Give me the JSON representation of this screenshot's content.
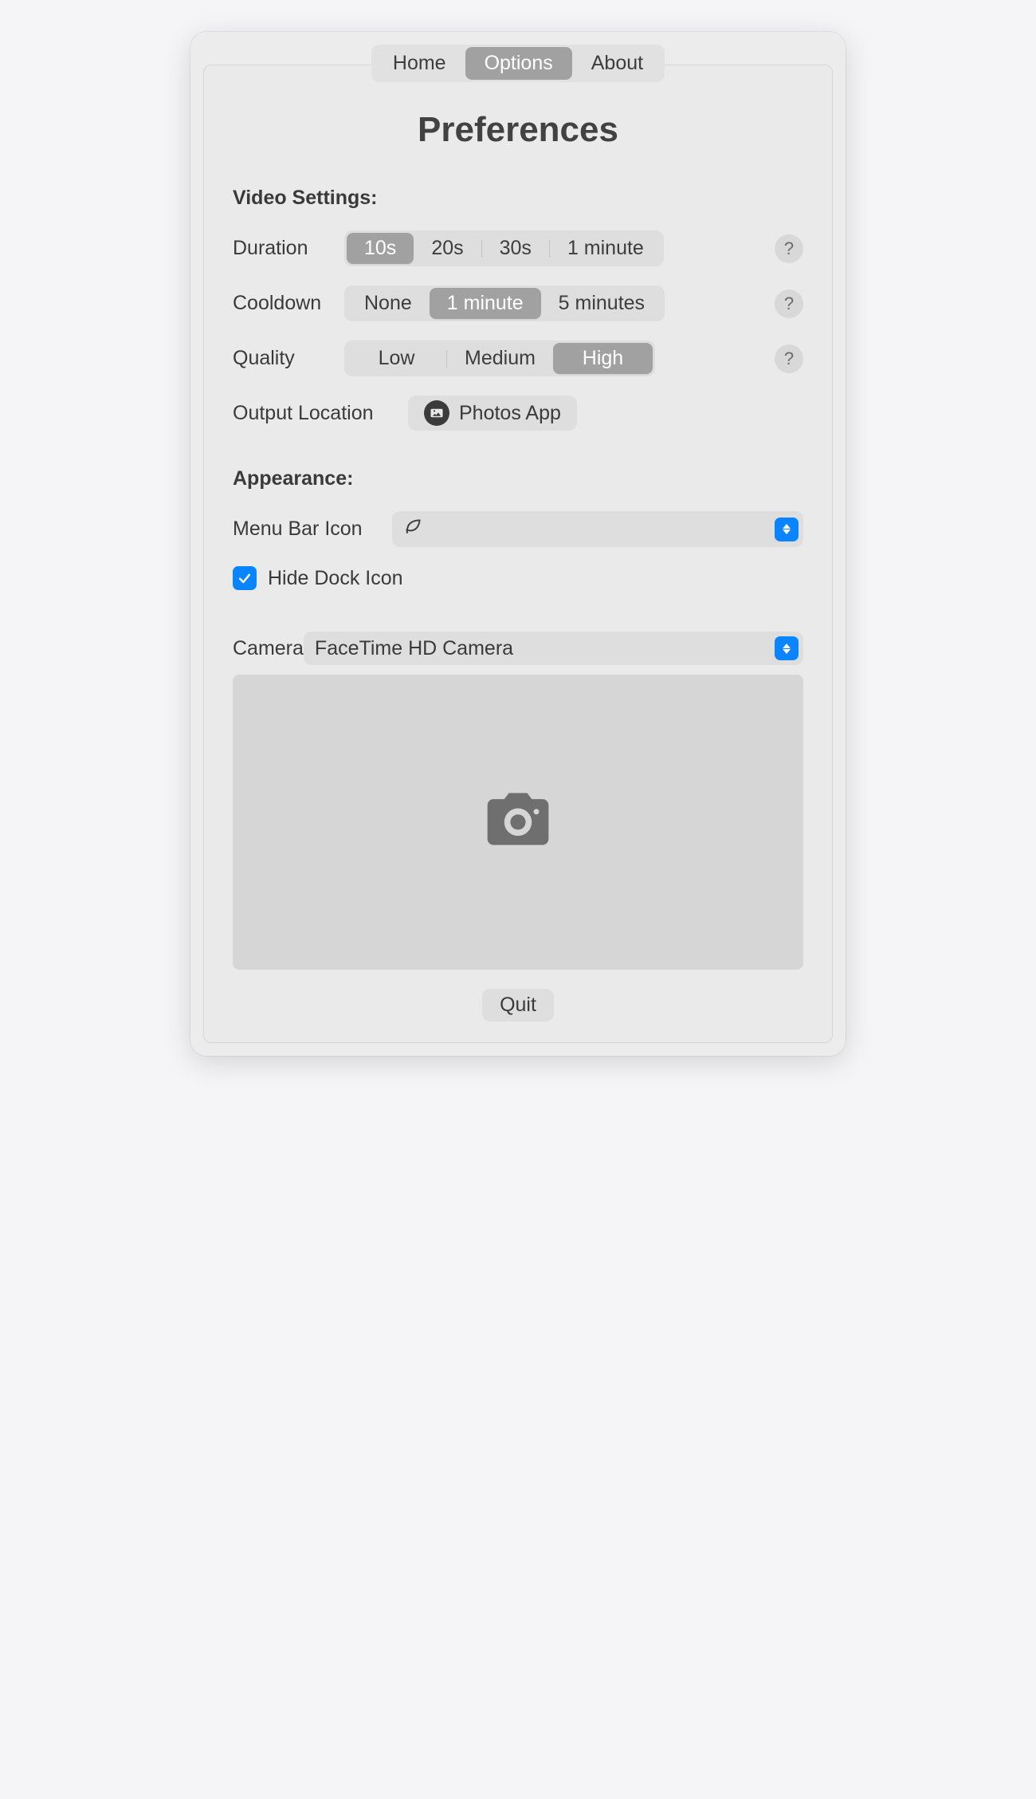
{
  "tabs": {
    "home": "Home",
    "options": "Options",
    "about": "About"
  },
  "title": "Preferences",
  "sections": {
    "video": "Video Settings:",
    "appearance": "Appearance:"
  },
  "labels": {
    "duration": "Duration",
    "cooldown": "Cooldown",
    "quality": "Quality",
    "output_location": "Output Location",
    "menu_bar_icon": "Menu Bar Icon",
    "hide_dock_icon": "Hide Dock Icon",
    "camera": "Camera"
  },
  "duration_options": [
    "10s",
    "20s",
    "30s",
    "1 minute"
  ],
  "duration_selected_index": 0,
  "cooldown_options": [
    "None",
    "1 minute",
    "5 minutes"
  ],
  "cooldown_selected_index": 1,
  "quality_options": [
    "Low",
    "Medium",
    "High"
  ],
  "quality_selected_index": 2,
  "output_location_value": "Photos App",
  "menu_bar_icon_value": "",
  "hide_dock_icon_checked": true,
  "camera_selected": "FaceTime HD Camera",
  "help_glyph": "?",
  "quit_label": "Quit"
}
